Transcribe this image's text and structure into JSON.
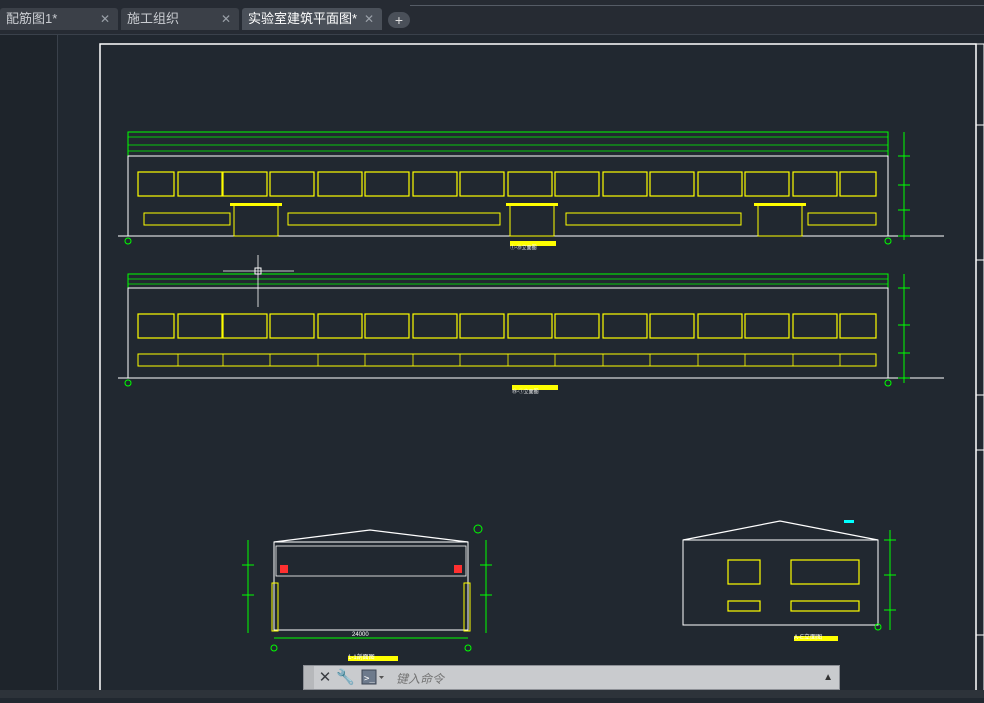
{
  "tabs": [
    {
      "label": "配筋图1*",
      "close": "✕"
    },
    {
      "label": "施工组织",
      "close": "✕"
    },
    {
      "label": "实验室建筑平面图*",
      "close": "✕"
    }
  ],
  "add_tab_label": "+",
  "drawing": {
    "elevation_top_label": "①-⑲立面图",
    "elevation_bottom_label": "⑲-①立面图",
    "section_label": "1-1剖面图",
    "section_width": "24000",
    "side_elevation_label": "A-E立面图"
  },
  "command": {
    "placeholder": "键入命令",
    "close_glyph": "✕",
    "settings_glyph": "🔧",
    "expand_glyph": "▲"
  },
  "colors": {
    "background": "#212830",
    "building_outline": "#ffffff",
    "windows": "#ffff00",
    "roof": "#00ff00",
    "dimensions": "#00ff00"
  }
}
